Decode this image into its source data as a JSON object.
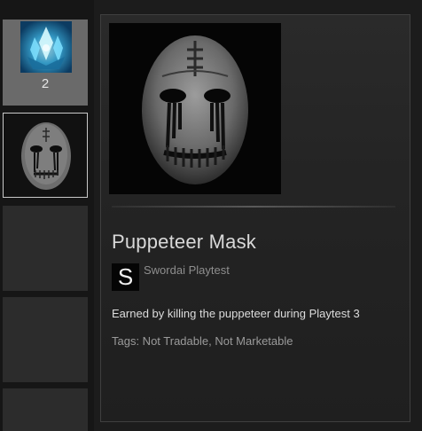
{
  "inventory": {
    "slots": [
      {
        "item": "crystal-icon",
        "count": "2",
        "selected": false
      },
      {
        "item": "mask-icon",
        "selected": true
      },
      {
        "item": "empty"
      },
      {
        "item": "empty"
      },
      {
        "item": "empty"
      }
    ]
  },
  "detail": {
    "item_name": "Puppeteer Mask",
    "app_icon_letter": "S",
    "app_name": "Swordai Playtest",
    "description": "Earned by killing the puppeteer during Playtest 3",
    "tags": "Tags: Not Tradable, Not Marketable"
  },
  "colors": {
    "background": "#1c1c1c",
    "panel": "#2a2a2a",
    "item_name": "#d8d8d8",
    "muted_text": "#8e8e8e"
  }
}
